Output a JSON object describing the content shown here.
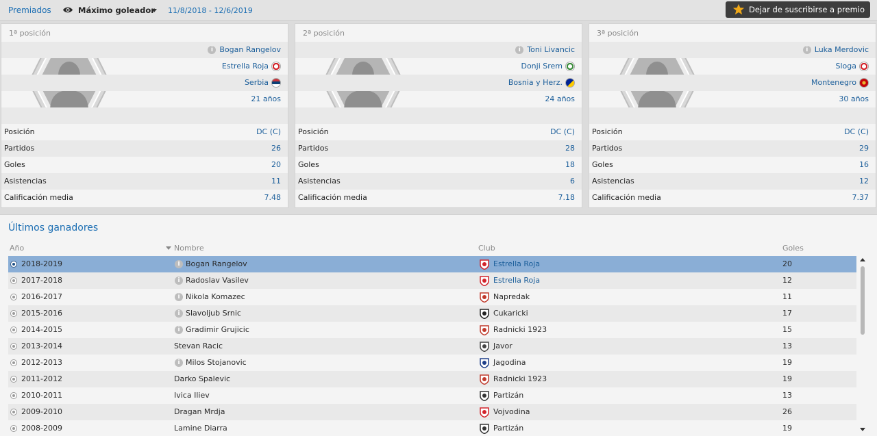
{
  "topbar": {
    "tab_label": "Premiados",
    "award_label": "Máximo goleador",
    "date_range": "11/8/2018 - 12/6/2019",
    "unsubscribe_label": "Dejar de suscribirse a premio"
  },
  "stats_labels": {
    "position": "Posición",
    "matches": "Partidos",
    "goals": "Goles",
    "assists": "Asistencias",
    "rating": "Calificación media"
  },
  "placings": [
    {
      "title": "1ª posición",
      "name": "Bogan Rangelov",
      "club": "Estrella Roja",
      "nation": "Serbia",
      "age": "21 años",
      "position": "DC (C)",
      "matches": "26",
      "goals": "20",
      "assists": "11",
      "rating": "7.48"
    },
    {
      "title": "2ª posición",
      "name": "Toni Livancic",
      "club": "Donji Srem",
      "nation": "Bosnia y Herz.",
      "age": "24 años",
      "position": "DC (C)",
      "matches": "28",
      "goals": "18",
      "assists": "6",
      "rating": "7.18"
    },
    {
      "title": "3ª posición",
      "name": "Luka Merdovic",
      "club": "Sloga",
      "nation": "Montenegro",
      "age": "30 años",
      "position": "DC (C)",
      "matches": "29",
      "goals": "16",
      "assists": "12",
      "rating": "7.37"
    }
  ],
  "winners": {
    "title": "Últimos ganadores",
    "columns": {
      "year": "Año",
      "name": "Nombre",
      "club": "Club",
      "goals": "Goles"
    },
    "rows": [
      {
        "year": "2018-2019",
        "name": "Bogan Rangelov",
        "club": "Estrella Roja",
        "goals": "20"
      },
      {
        "year": "2017-2018",
        "name": "Radoslav Vasilev",
        "club": "Estrella Roja",
        "goals": "12"
      },
      {
        "year": "2016-2017",
        "name": "Nikola Komazec",
        "club": "Napredak",
        "goals": "11"
      },
      {
        "year": "2015-2016",
        "name": "Slavoljub Srnic",
        "club": "Cukaricki",
        "goals": "17"
      },
      {
        "year": "2014-2015",
        "name": "Gradimir Grujicic",
        "club": "Radnicki 1923",
        "goals": "15"
      },
      {
        "year": "2013-2014",
        "name": "Stevan Racic",
        "club": "Javor",
        "goals": "13"
      },
      {
        "year": "2012-2013",
        "name": "Milos Stojanovic",
        "club": "Jagodina",
        "goals": "19"
      },
      {
        "year": "2011-2012",
        "name": "Darko Spalevic",
        "club": "Radnicki 1923",
        "goals": "19"
      },
      {
        "year": "2010-2011",
        "name": "Ivica Iliev",
        "club": "Partizán",
        "goals": "13"
      },
      {
        "year": "2009-2010",
        "name": "Dragan Mrdja",
        "club": "Vojvodina",
        "goals": "26"
      },
      {
        "year": "2008-2009",
        "name": "Lamine Diarra",
        "club": "Partizán",
        "goals": "19"
      }
    ]
  },
  "colors": {
    "accent": "#1b6eb3",
    "selected_row": "#8aaed6",
    "unsubscribe_bg": "#3d3d3d",
    "star": "#f0a818"
  },
  "icons": [
    "eye-icon",
    "chevron-down-icon",
    "star-icon",
    "info-icon",
    "club-crest-icon",
    "flag-icon",
    "radio-icon",
    "scroll-up-icon",
    "scroll-down-icon"
  ]
}
